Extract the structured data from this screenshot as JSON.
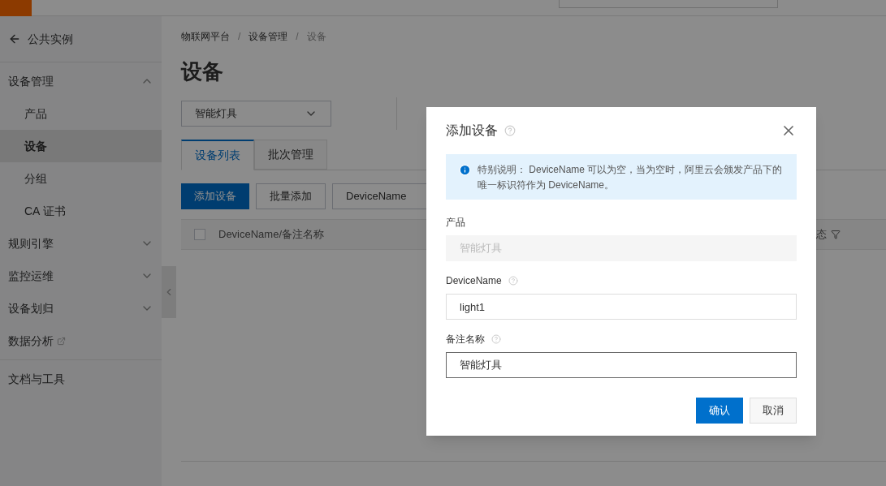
{
  "sidebar": {
    "back": "公共实例",
    "items": [
      {
        "kind": "group",
        "label": "设备管理",
        "expanded": true,
        "children": [
          {
            "label": "产品",
            "selected": false
          },
          {
            "label": "设备",
            "selected": true
          },
          {
            "label": "分组",
            "selected": false
          },
          {
            "label": "CA 证书",
            "selected": false
          }
        ]
      },
      {
        "kind": "group",
        "label": "规则引擎",
        "expanded": false
      },
      {
        "kind": "group",
        "label": "监控运维",
        "expanded": false
      },
      {
        "kind": "group",
        "label": "设备划归",
        "expanded": false
      },
      {
        "kind": "external",
        "label": "数据分析"
      }
    ],
    "footer_items": [
      {
        "label": "文档与工具"
      }
    ]
  },
  "breadcrumb": [
    "物联网平台",
    "设备管理",
    "设备"
  ],
  "breadcrumb_separator": "/",
  "title": "设备",
  "product_select": {
    "value": "智能灯具"
  },
  "tabs": [
    {
      "label": "设备列表",
      "selected": true
    },
    {
      "label": "批次管理",
      "selected": false
    }
  ],
  "toolbar": {
    "add_button": "添加设备",
    "batch_button": "批量添加",
    "search_select": "DeviceName"
  },
  "table": {
    "select_all_checked": false,
    "columns": [
      {
        "label": "DeviceName/备注名称"
      },
      {
        "label": "态"
      }
    ]
  },
  "dialog": {
    "title": "添加设备",
    "notice": "特别说明： DeviceName 可以为空，当为空时，阿里云会颁发产品下的唯一标识符作为 DeviceName。",
    "fields": [
      {
        "label": "产品",
        "value": "智能灯具",
        "disabled": true,
        "help": false,
        "focused": false
      },
      {
        "label": "DeviceName",
        "value": "light1",
        "disabled": false,
        "help": true,
        "focused": false
      },
      {
        "label": "备注名称",
        "value": "智能灯具",
        "disabled": false,
        "help": true,
        "focused": true
      }
    ],
    "confirm": "确认",
    "cancel": "取消"
  }
}
